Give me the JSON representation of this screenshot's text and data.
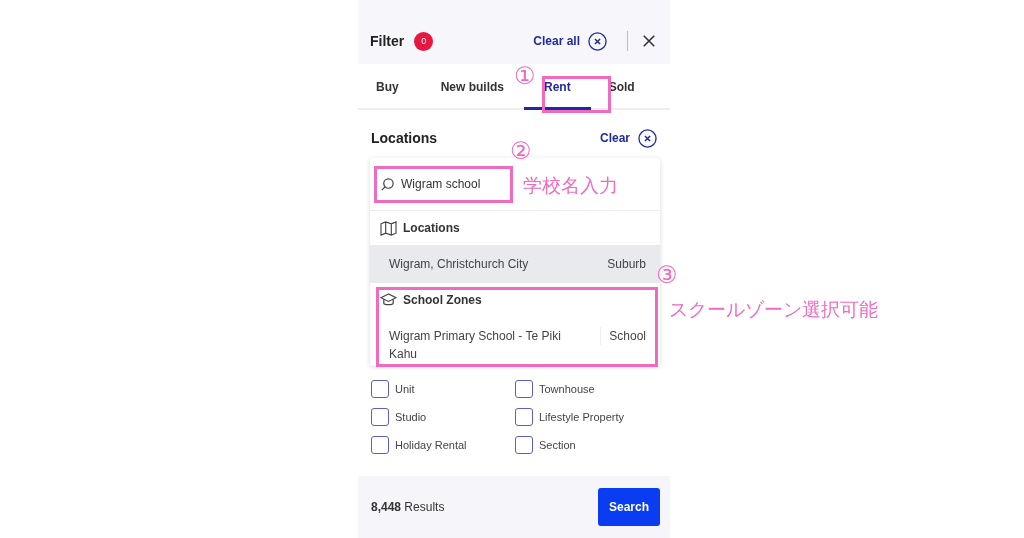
{
  "header": {
    "title": "Filter",
    "badge": "0",
    "clear_all": "Clear all"
  },
  "tabs": [
    {
      "label": "Buy",
      "selected": false
    },
    {
      "label": "New builds",
      "selected": false
    },
    {
      "label": "Rent",
      "selected": true
    },
    {
      "label": "Sold",
      "selected": false
    }
  ],
  "locations": {
    "heading": "Locations",
    "clear": "Clear"
  },
  "dropdown": {
    "search_value": "Wigram school",
    "sections": [
      {
        "kind": "map",
        "title": "Locations",
        "results": [
          {
            "name": "Wigram, Christchurch City",
            "type": "Suburb",
            "highlighted": true
          }
        ]
      },
      {
        "kind": "school",
        "title": "School Zones",
        "results": [
          {
            "name": "Wigram Primary School - Te Piki Kahu",
            "type": "School",
            "highlighted": false
          }
        ]
      }
    ]
  },
  "property_types": [
    {
      "label": "Unit",
      "checked": false
    },
    {
      "label": "Townhouse",
      "checked": false
    },
    {
      "label": "Studio",
      "checked": false
    },
    {
      "label": "Lifestyle Property",
      "checked": false
    },
    {
      "label": "Holiday Rental",
      "checked": false
    },
    {
      "label": "Section",
      "checked": false
    }
  ],
  "footer": {
    "results": "**8,448** Results",
    "search_button": "Search"
  },
  "annotations": [
    {
      "number": "①"
    },
    {
      "number": "②",
      "label": "学校名入力"
    },
    {
      "number": "③",
      "label": "スクールゾーン選択可能"
    }
  ]
}
